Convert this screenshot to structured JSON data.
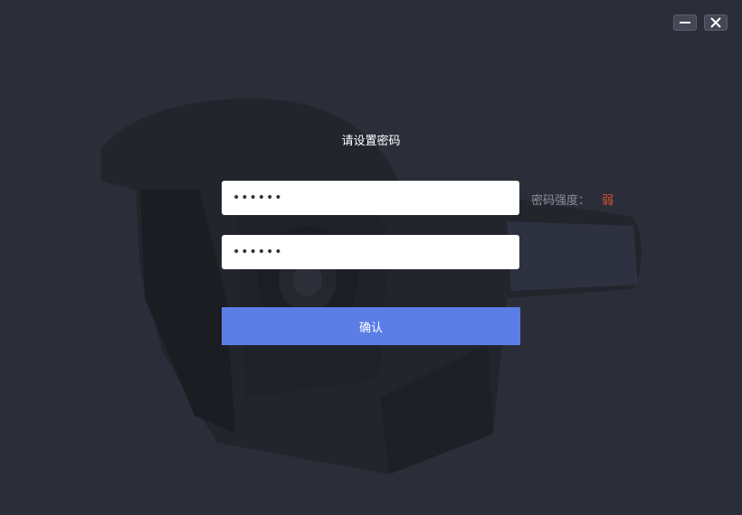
{
  "window": {
    "minimize_icon": "minimize-icon",
    "close_icon": "close-icon"
  },
  "form": {
    "title": "请设置密码",
    "password_value": "••••••",
    "confirm_password_value": "••••••",
    "strength_label": "密码强度：",
    "strength_value": "弱",
    "strength_color": "#e0522c",
    "confirm_label": "确认"
  },
  "colors": {
    "background": "#2b2e38",
    "accent": "#5b7ee6"
  }
}
